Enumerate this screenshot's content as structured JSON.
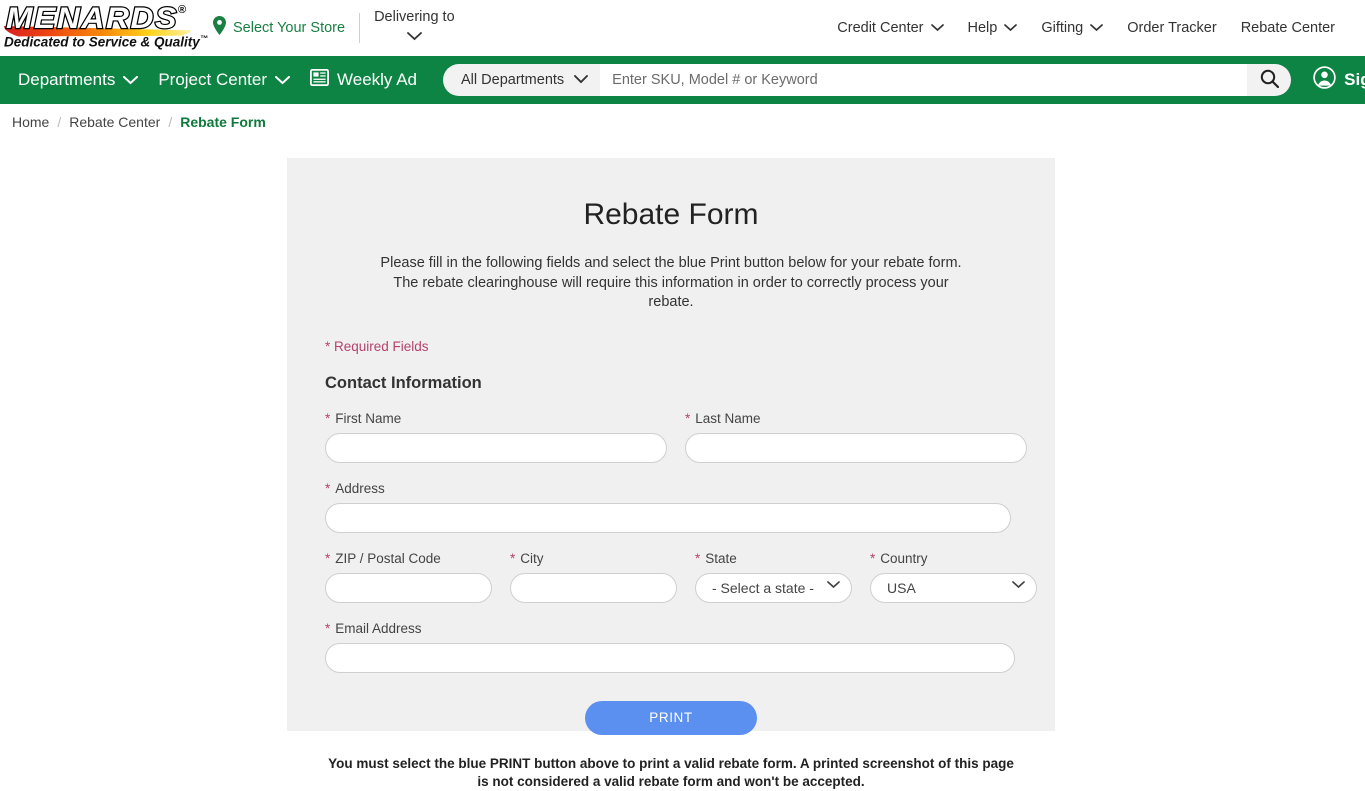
{
  "brand": {
    "logo_word": "MENARDS",
    "logo_registered": "®",
    "logo_tagline": "Dedicated to Service & Quality",
    "logo_tagline_tm": "™",
    "green": "#0d8443",
    "accent_blue": "#5b8ff0",
    "required_red": "#b4436c"
  },
  "topbar": {
    "store_select_label": "Select Your Store",
    "delivering_label": "Delivering to",
    "nav": [
      {
        "label": "Credit Center",
        "has_chevron": true
      },
      {
        "label": "Help",
        "has_chevron": true
      },
      {
        "label": "Gifting",
        "has_chevron": true
      },
      {
        "label": "Order Tracker",
        "has_chevron": false
      },
      {
        "label": "Rebate Center",
        "has_chevron": false
      }
    ]
  },
  "greenbar": {
    "departments_label": "Departments",
    "project_center_label": "Project Center",
    "weekly_ad_label": "Weekly Ad",
    "dept_filter_value": "All Departments",
    "search_placeholder": "Enter SKU, Model # or Keyword",
    "search_value": "",
    "signin_label": "Sign In"
  },
  "breadcrumb": {
    "home": "Home",
    "sep": "/",
    "rebate_center": "Rebate Center",
    "current": "Rebate Form"
  },
  "form": {
    "title": "Rebate Form",
    "description": "Please fill in the following fields and select the blue Print button below for your rebate form. The rebate clearinghouse will require this information in order to correctly process your rebate.",
    "required_note": "* Required Fields",
    "section_title": "Contact Information",
    "star": "*",
    "fields": {
      "first_name": {
        "label": "First Name",
        "value": "",
        "placeholder": ""
      },
      "last_name": {
        "label": "Last Name",
        "value": "",
        "placeholder": ""
      },
      "address": {
        "label": "Address",
        "value": "",
        "placeholder": ""
      },
      "zip": {
        "label": "ZIP / Postal Code",
        "value": "",
        "placeholder": ""
      },
      "city": {
        "label": "City",
        "value": "",
        "placeholder": ""
      },
      "state": {
        "label": "State",
        "value": "- Select a state -"
      },
      "country": {
        "label": "Country",
        "value": "USA"
      },
      "email": {
        "label": "Email Address",
        "value": "",
        "placeholder": ""
      }
    },
    "print_button": "PRINT",
    "footer_note": "You must select the blue PRINT button above to print a valid rebate form. A printed screenshot of this page is not considered a valid rebate form and won't be accepted."
  }
}
